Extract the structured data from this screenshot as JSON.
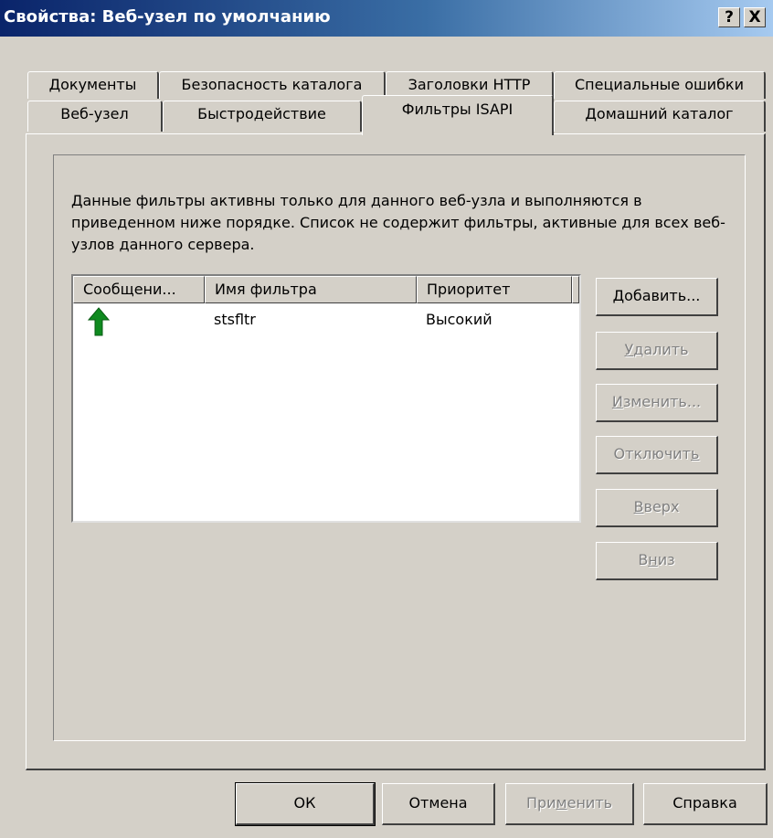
{
  "window": {
    "title": "Свойства: Веб-узел по умолчанию"
  },
  "title_buttons": {
    "help": "?",
    "close": "X"
  },
  "tabs": {
    "row1": [
      "Документы",
      "Безопасность каталога",
      "Заголовки HTTP",
      "Специальные ошибки"
    ],
    "row2": [
      "Веб-узел",
      "Быстродействие",
      "Фильтры ISAPI",
      "Домашний каталог"
    ],
    "active": "Фильтры ISAPI"
  },
  "description": "Данные фильтры активны только для данного веб-узла и выполняются в приведенном ниже порядке. Список не содержит фильтры, активные для всех веб-узлов данного сервера.",
  "filter_list": {
    "columns": [
      "Сообщени...",
      "Имя фильтра",
      "Приоритет"
    ],
    "rows": [
      {
        "status_icon": "green-up-arrow-icon",
        "name": "stsfltr",
        "priority": "Высокий"
      }
    ]
  },
  "side_buttons": {
    "add": "Добавить...",
    "remove": "Удалить",
    "edit": "Изменить...",
    "disable": "Отключить",
    "up": "Вверх",
    "down": "Вниз"
  },
  "dialog_buttons": {
    "ok": "ОК",
    "cancel": "Отмена",
    "apply": "Применить",
    "help": "Справка"
  },
  "colors": {
    "title_start": "#0a246a",
    "title_end": "#a6caf0",
    "face": "#d4d0c8",
    "status_icon": "#0f8a1f"
  }
}
